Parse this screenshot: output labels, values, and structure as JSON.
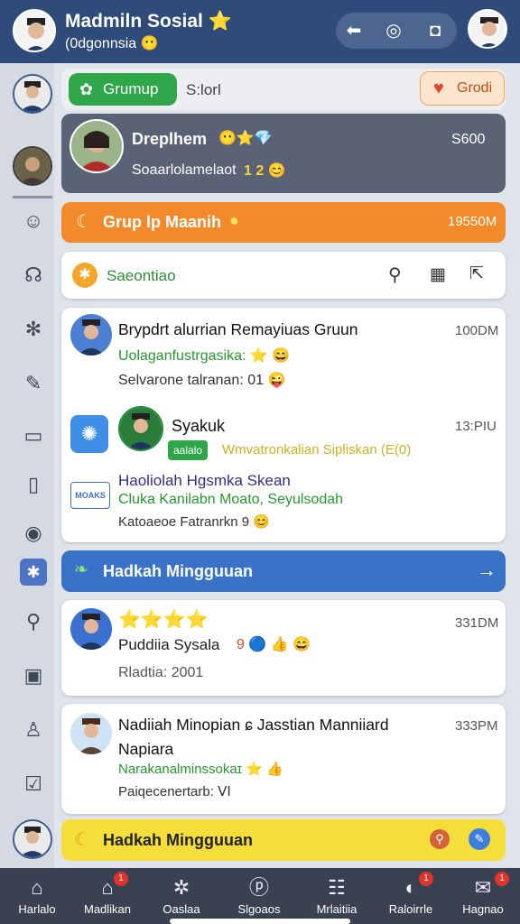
{
  "header": {
    "title": "Madmiln Sosial ⭐",
    "subtitle": "(0dgonnsia 😶",
    "actions": [
      {
        "icon": "back-arrow-icon",
        "glyph": "⬅"
      },
      {
        "icon": "refresh-icon",
        "glyph": "◎"
      },
      {
        "icon": "camera-icon",
        "glyph": "◘"
      }
    ]
  },
  "toolbar": {
    "group_label": "Grumup",
    "search_label": "S:lorl",
    "action_label": "Grodi"
  },
  "featured": {
    "name": "Dreplhem",
    "emojis": "😶⭐💎",
    "time": "S600",
    "subtitle": "Soaarlolamelaot",
    "subtitle_emojis": "1 2 😊"
  },
  "group_header": {
    "label": "Grup lp Maanih",
    "time": "19550M"
  },
  "second_toolbar": {
    "label": "Saeontiao"
  },
  "messages": [
    {
      "title": "Brypdrt alurrian Remayiuas Gruun",
      "time": "100DM",
      "line2": "Uolaganfustrgasika: ⭐ 😄",
      "line3": "Selvarone talranan: 01 😜"
    },
    {
      "title": "Syakuk",
      "time": "13:PIU",
      "line2_prefix": "aalalo",
      "line2": "Wmvatronkalian Sipliskan (E(0)"
    },
    {
      "title": "Haoliolah Hgsmka Skean",
      "line2": "Cluka Kanilabn Moato, Seyulsodah",
      "line3": "Katoaeoe Fatranrkn 9 😊",
      "badge_text": "MOAKS"
    }
  ],
  "weekly_header": {
    "label": "Hadkah Mingguuan",
    "arrow": "→"
  },
  "cards": [
    {
      "stars": "⭐⭐⭐⭐",
      "time": "331DM",
      "line2": "Puddiia Sysala",
      "line2_emojis": "9 🔵 👍 😄",
      "line3": "Rladtia: 2001"
    },
    {
      "title": "Nadiiah Minopian ɕ Jasstian Manniiard",
      "time": "333PM",
      "title2": "Napiara",
      "line2": "Narakanalminssokaɪ ⭐ 👍",
      "line3": "Paiqecenertarb: ⅤⅠ"
    }
  ],
  "bottom_strip": {
    "label": "Hadkah Mingguuan"
  },
  "bottom_nav": [
    {
      "label": "Harlalo",
      "icon": "home-icon",
      "glyph": "⌂",
      "badge": ""
    },
    {
      "label": "Madlikan",
      "icon": "house-icon",
      "glyph": "⌂",
      "badge": "1"
    },
    {
      "label": "Oaslaa",
      "icon": "puzzle-icon",
      "glyph": "✲",
      "badge": ""
    },
    {
      "label": "Slgoaos",
      "icon": "circle-p-icon",
      "glyph": "ⓟ",
      "badge": ""
    },
    {
      "label": "Mrlaitiia",
      "icon": "users-icon",
      "glyph": "☷",
      "badge": ""
    },
    {
      "label": "Raloirrle",
      "icon": "chat-icon",
      "glyph": "◐",
      "badge": "1"
    },
    {
      "label": "Hagnao",
      "icon": "mail-icon",
      "glyph": "✉",
      "badge": "1"
    }
  ],
  "colors": {
    "header": "#2f4b7a",
    "accent_green": "#2fa64a",
    "accent_orange": "#f2892b",
    "accent_blue": "#3a72c8",
    "accent_yellow": "#f6de3a",
    "nav_bg": "#3a4251"
  }
}
